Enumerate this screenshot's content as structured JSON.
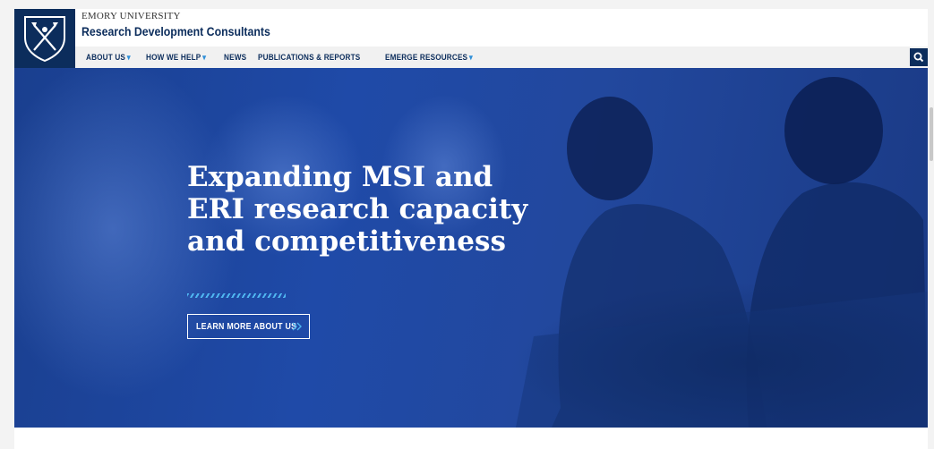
{
  "header": {
    "university": "EMORY UNIVERSITY",
    "site_title": "Research Development Consultants"
  },
  "nav": {
    "items": [
      {
        "label": "ABOUT US",
        "has_dropdown": true
      },
      {
        "label": "HOW WE HELP",
        "has_dropdown": true
      },
      {
        "label": "NEWS",
        "has_dropdown": false
      },
      {
        "label": "PUBLICATIONS & REPORTS",
        "has_dropdown": false
      },
      {
        "label": "EMERGE RESOURCES",
        "has_dropdown": true
      }
    ],
    "caret": "⌄",
    "search_icon": "search-icon"
  },
  "hero": {
    "title_lines": [
      "Expanding MSI and",
      "ERI research capacity",
      "and competitiveness"
    ],
    "cta_label": "LEARN MORE ABOUT US",
    "cta_icon": "double-chevron-right-icon"
  },
  "colors": {
    "brand_navy": "#0c2d5c",
    "hero_blue": "#1f4aa8",
    "accent_light_blue": "#4fb6f0"
  }
}
